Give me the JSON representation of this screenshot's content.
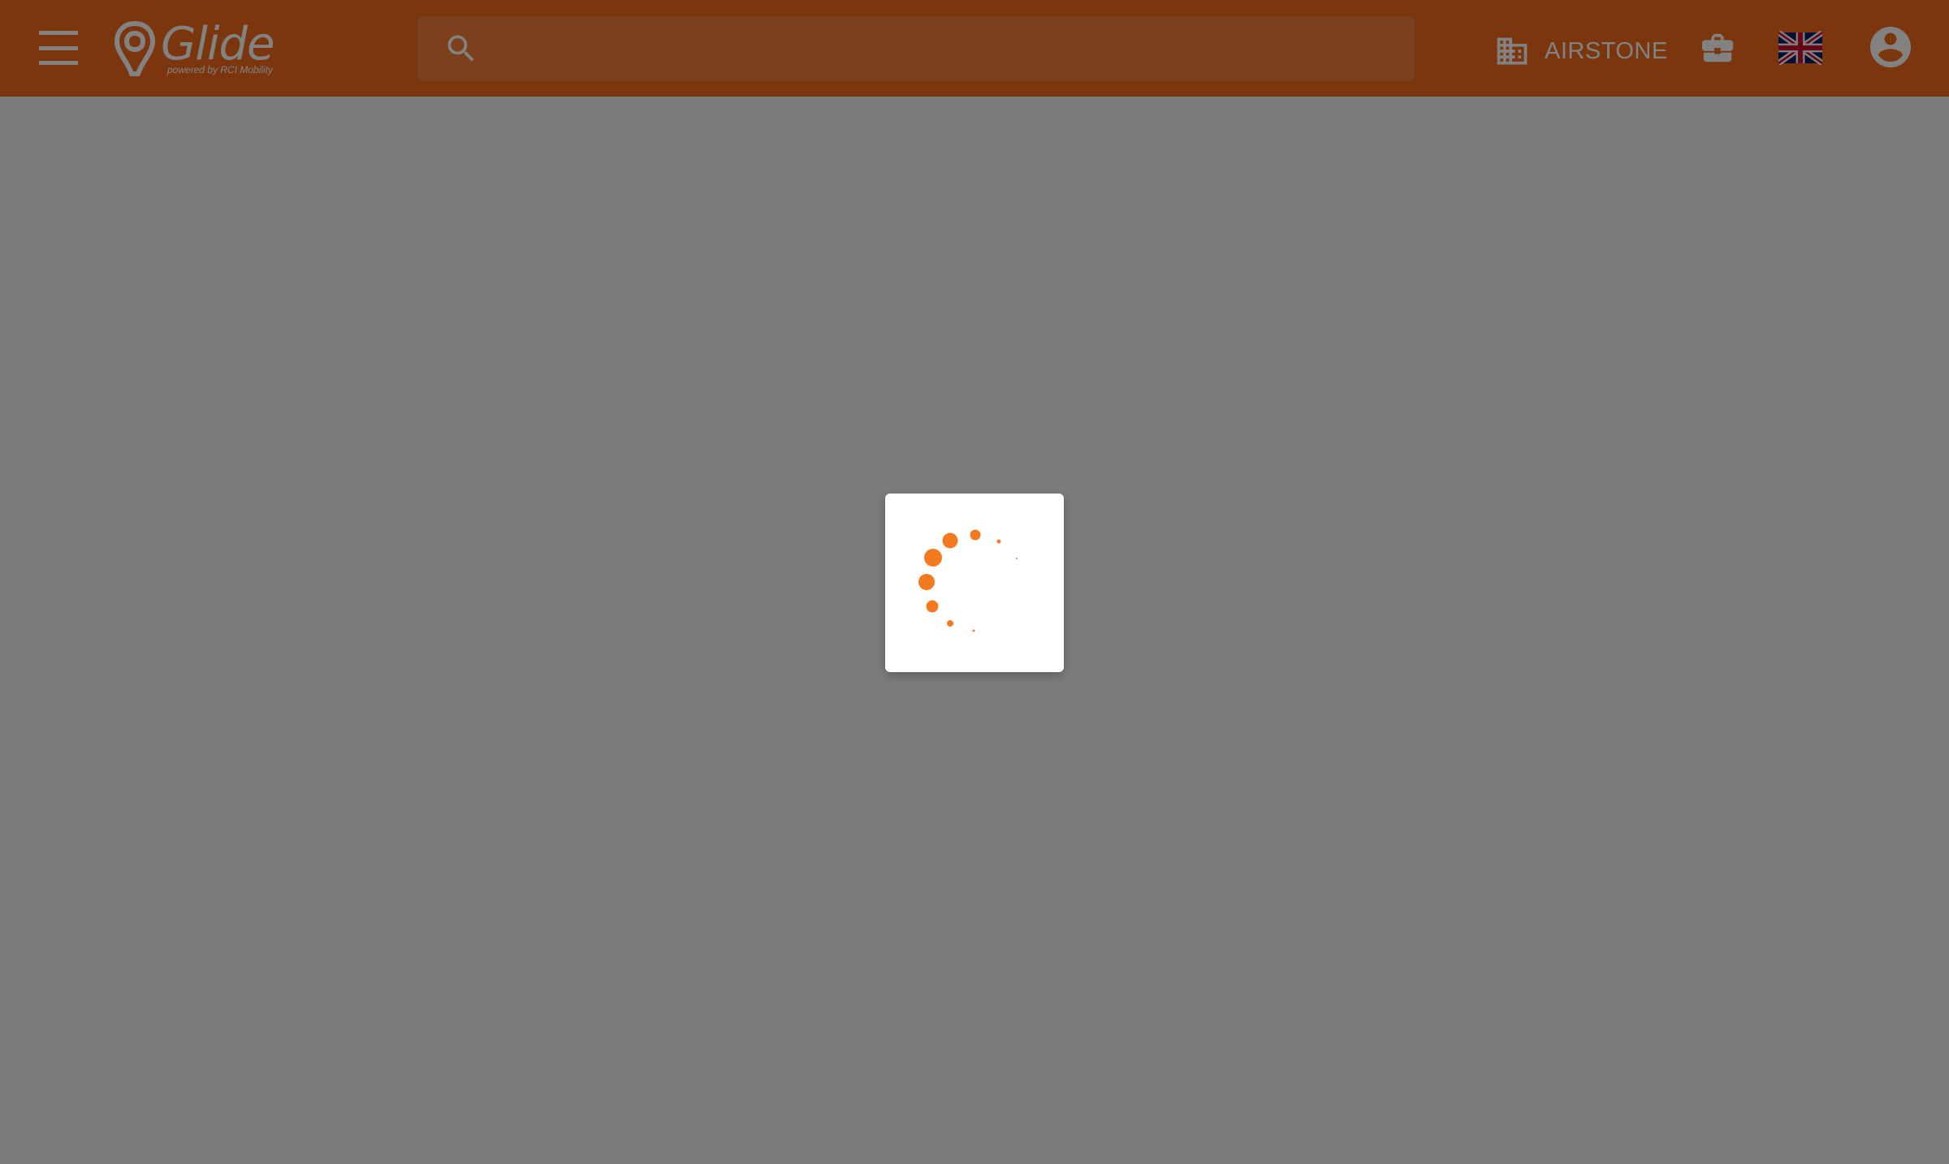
{
  "app": {
    "logo_word": "Glide",
    "logo_subtitle": "powered by RCI Mobility"
  },
  "header": {
    "menu_icon": "menu-icon",
    "search_placeholder": "",
    "search_value": "",
    "company_icon": "building-icon",
    "company_name": "AIRSTONE",
    "briefcase_icon": "briefcase-icon",
    "language_flag": "uk-flag-icon",
    "account_icon": "account-circle-icon"
  },
  "loader": {
    "icon": "loading-spinner-icon"
  },
  "colors": {
    "brand": "#f26b1d",
    "overlay": "rgba(0,0,0,0.49)",
    "spinner": "#f47a20",
    "white": "#ffffff"
  }
}
